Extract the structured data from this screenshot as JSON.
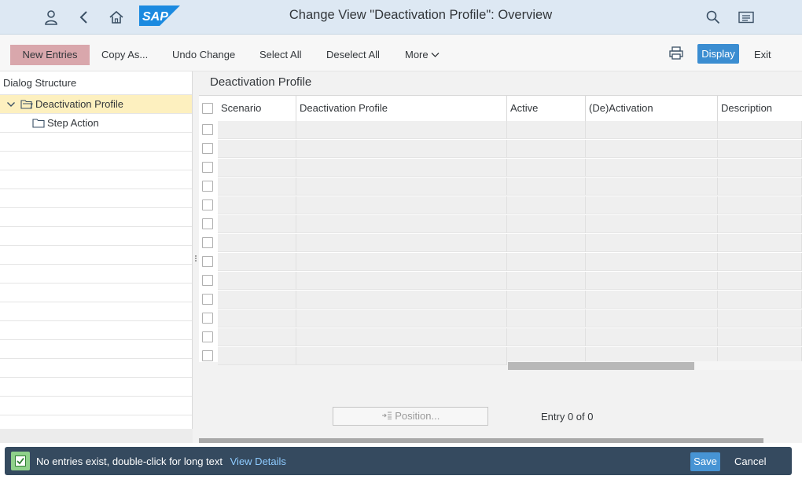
{
  "shell": {
    "title": "Change View \"Deactivation Profile\": Overview",
    "logo_text": "SAP",
    "icons": [
      "user-icon",
      "back-icon",
      "home-icon",
      "search-icon",
      "menu-icon"
    ]
  },
  "toolbar": {
    "new_entries": "New Entries",
    "copy_as": "Copy As...",
    "undo_change": "Undo Change",
    "select_all": "Select All",
    "deselect_all": "Deselect All",
    "more": "More",
    "display": "Display",
    "exit": "Exit"
  },
  "dialog": {
    "header": "Dialog Structure",
    "items": [
      {
        "label": "Deactivation Profile",
        "selected": true
      },
      {
        "label": "Step Action",
        "selected": false
      }
    ]
  },
  "main": {
    "title": "Deactivation Profile",
    "columns": [
      "Scenario",
      "Deactivation Profile",
      "Active",
      "(De)Activation",
      "Description"
    ],
    "position_button": "Position...",
    "entry_text": "Entry 0 of 0"
  },
  "status": {
    "message": "No entries exist, double-click for long text",
    "link": "View Details",
    "save": "Save",
    "cancel": "Cancel"
  },
  "colors": {
    "shell_bg": "#dde8f3",
    "accent": "#3b8dd1",
    "status_bg": "#354a5f",
    "selected_row": "#fdf0bf"
  }
}
